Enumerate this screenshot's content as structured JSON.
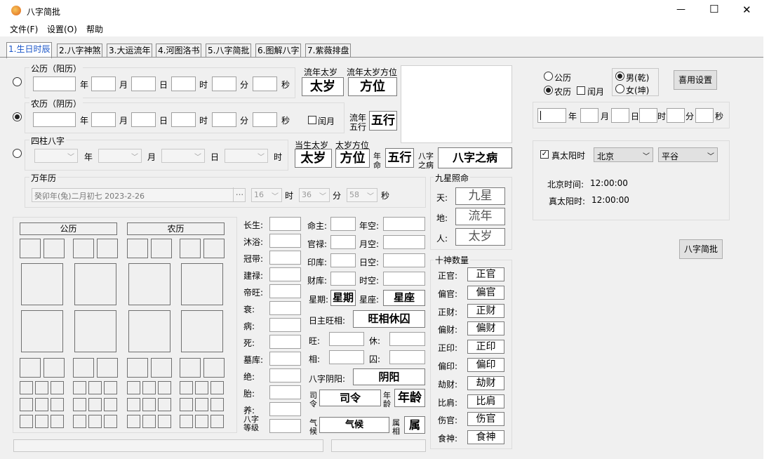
{
  "window": {
    "title": "八字简批",
    "minimize": "—",
    "maximize": "☐",
    "close": "✕"
  },
  "menu": [
    "文件(F)",
    "设置(O)",
    "帮助"
  ],
  "tabs": [
    "1.生日时辰",
    "2.八字神煞",
    "3.大运流年",
    "4.河图洛书",
    "5.八字简批",
    "6.图解八字",
    "7.紫薇排盘"
  ],
  "solar": {
    "legend": "公历（阳历）",
    "year": "年",
    "month": "月",
    "day": "日",
    "hour": "时",
    "minute": "分",
    "second": "秒"
  },
  "lunar": {
    "legend": "农历（阴历）",
    "year": "年",
    "month": "月",
    "day": "日",
    "hour": "时",
    "minute": "分",
    "second": "秒",
    "leap": "闰月"
  },
  "pillars": {
    "legend": "四柱八字",
    "year": "年",
    "month": "月",
    "day": "日",
    "hour": "时"
  },
  "taisui": {
    "h1": "流年太岁",
    "h2": "流年太岁方位",
    "b1": "太岁",
    "b2": "方位",
    "wx_label_1": "流年",
    "wx_label_2": "五行",
    "wx": "五行"
  },
  "dangsheng": {
    "h1": "当生太岁",
    "h2": "太岁方位",
    "b1": "太岁",
    "b2": "方位",
    "nm1": "年",
    "nm2": "命",
    "wx": "五行",
    "bz1": "八字",
    "bz2": "之病",
    "disease": "八字之病"
  },
  "wannian": {
    "legend": "万年历",
    "value": "癸卯年(兔)二月初七  2023-2-26",
    "dots": "...",
    "hour": "16",
    "hour_u": "时",
    "minute": "36",
    "minute_u": "分",
    "second": "58",
    "second_u": "秒"
  },
  "chart": {
    "solar": "公历",
    "lunar": "农历"
  },
  "changsheng": [
    "长生:",
    "沐浴:",
    "冠带:",
    "建禄:",
    "帝旺:",
    "衰:",
    "病:",
    "死:",
    "墓库:",
    "绝:",
    "胎:",
    "养:"
  ],
  "bazi_level": [
    "八字",
    "等级"
  ],
  "mid_col": {
    "mingzhu": "命主:",
    "guanlu": "官禄:",
    "yinku": "印库:",
    "caiku": "财库:",
    "niankong": "年空:",
    "yuekong": "月空:",
    "rikong": "日空:",
    "shikong": "时空:",
    "xingqi": "星期:",
    "xingqi_val": "星期",
    "xingzuo": "星座:",
    "xingzuo_val": "星座",
    "rizhu": "日主旺相:",
    "rizhu_val": "旺相休囚",
    "wang": "旺:",
    "xiu": "休:",
    "xiang": "相:",
    "qiu": "囚:",
    "yinyang": "八字阴阳:",
    "yinyang_val": "阴阳",
    "si1": "司",
    "si2": "令",
    "siling": "司令",
    "nl1": "年",
    "nl2": "龄",
    "nianling": "年龄",
    "qh1": "气",
    "qh2": "候",
    "qihou": "气候",
    "sx1": "属",
    "sx2": "相",
    "shu": "属"
  },
  "jiuxing": {
    "legend": "九星照命",
    "tian": "天:",
    "tian_val": "九星",
    "di": "地:",
    "di_val": "流年",
    "ren": "人:",
    "ren_val": "太岁"
  },
  "shishen": {
    "legend": "十神数量",
    "items": [
      {
        "l": "正官:",
        "v": "正官"
      },
      {
        "l": "偏官:",
        "v": "偏官"
      },
      {
        "l": "正财:",
        "v": "正财"
      },
      {
        "l": "偏财:",
        "v": "偏财"
      },
      {
        "l": "正印:",
        "v": "正印"
      },
      {
        "l": "偏印:",
        "v": "偏印"
      },
      {
        "l": "劫财:",
        "v": "劫财"
      },
      {
        "l": "比肩:",
        "v": "比肩"
      },
      {
        "l": "伤官:",
        "v": "伤官"
      },
      {
        "l": "食神:",
        "v": "食神"
      }
    ]
  },
  "right": {
    "solar": "公历",
    "lunar": "农历",
    "leap": "闰月",
    "male": "男(乾)",
    "female": "女(坤)",
    "settings": "喜用设置",
    "year": "年",
    "month": "月",
    "day": "日",
    "hour": "时",
    "minute": "分",
    "second": "秒",
    "truesun": "真太阳时",
    "city": "北京",
    "district": "平谷",
    "bj_label": "北京时间:",
    "bj_time": "12:00:00",
    "ts_label": "真太阳时:",
    "ts_time": "12:00:00",
    "jianpi": "八字简批"
  }
}
